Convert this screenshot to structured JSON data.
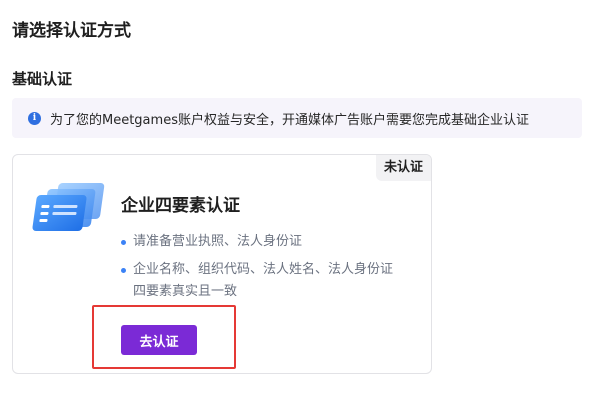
{
  "page": {
    "title": "请选择认证方式"
  },
  "section": {
    "title": "基础认证"
  },
  "notice": {
    "icon": "info-icon",
    "text": "为了您的Meetgames账户权益与安全，开通媒体广告账户需要您完成基础企业认证",
    "accent_color": "#2f6fe0"
  },
  "card": {
    "status": "未认证",
    "title": "企业四要素认证",
    "illustration": "stacked-cards-illustration",
    "requirements": [
      {
        "lines": [
          "请准备营业执照、法人身份证"
        ]
      },
      {
        "lines": [
          "企业名称、组织代码、法人姓名、法人身份证",
          "四要素真实且一致"
        ]
      }
    ],
    "button_label": "去认证",
    "button_color": "#7b2ad6",
    "highlight_color": "#e53935"
  }
}
